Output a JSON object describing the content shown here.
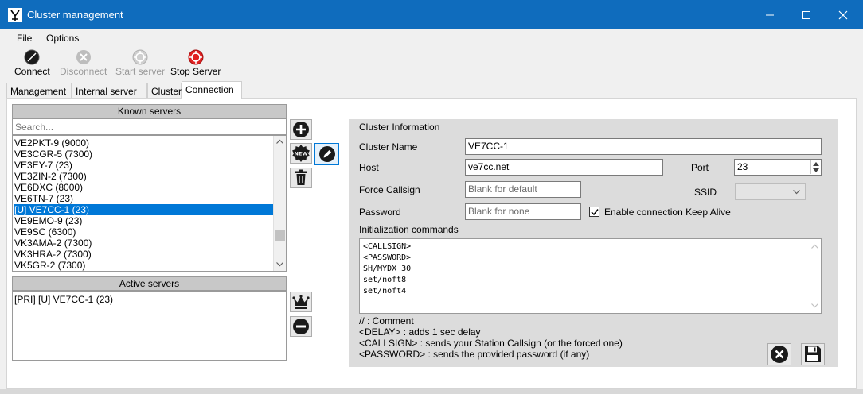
{
  "window": {
    "title": "Cluster management"
  },
  "menu": [
    "File",
    "Options"
  ],
  "toolbar": {
    "connect": "Connect",
    "disconnect": "Disconnect",
    "start_server": "Start server",
    "stop_server": "Stop Server"
  },
  "tabs": [
    "Management",
    "Internal server",
    "Cluster",
    "Connection"
  ],
  "active_tab": "Connection",
  "known_servers": {
    "header": "Known servers",
    "search_placeholder": "Search...",
    "items": [
      "VE2PKT-9 (9000)",
      "VE3CGR-5 (7300)",
      "VE3EY-7 (23)",
      "VE3ZIN-2 (7300)",
      "VE6DXC (8000)",
      "VE6TN-7 (23)",
      "[U] VE7CC-1 (23)",
      "VE9EMO-9 (23)",
      "VE9SC (6300)",
      "VK3AMA-2 (7300)",
      "VK3HRA-2 (7300)",
      "VK5GR-2 (7300)"
    ],
    "selected": "[U] VE7CC-1 (23)"
  },
  "active_servers": {
    "header": "Active servers",
    "items": [
      "[PRI] [U] VE7CC-1 (23)"
    ]
  },
  "cluster_info": {
    "title": "Cluster Information",
    "cluster_name_label": "Cluster Name",
    "cluster_name": "VE7CC-1",
    "host_label": "Host",
    "host": "ve7cc.net",
    "port_label": "Port",
    "port": "23",
    "force_callsign_label": "Force Callsign",
    "force_callsign_placeholder": "Blank for default",
    "ssid_label": "SSID",
    "ssid": "",
    "password_label": "Password",
    "password_placeholder": "Blank for none",
    "keep_alive_label": "Enable connection Keep Alive",
    "keep_alive": true,
    "init_label": "Initialization commands",
    "init_commands": [
      "<CALLSIGN>",
      "<PASSWORD>",
      "SH/MYDX 30",
      "set/noft8",
      "set/noft4"
    ],
    "notes": [
      "// : Comment",
      "<DELAY> : adds 1 sec delay",
      "<CALLSIGN> : sends your Station Callsign (or the forced one)",
      "<PASSWORD> : sends the provided password (if any)"
    ]
  },
  "colors": {
    "titlebar": "#0f6cbd",
    "selection": "#0078d7",
    "panel": "#dcdcdc",
    "stop_red": "#e02020"
  }
}
